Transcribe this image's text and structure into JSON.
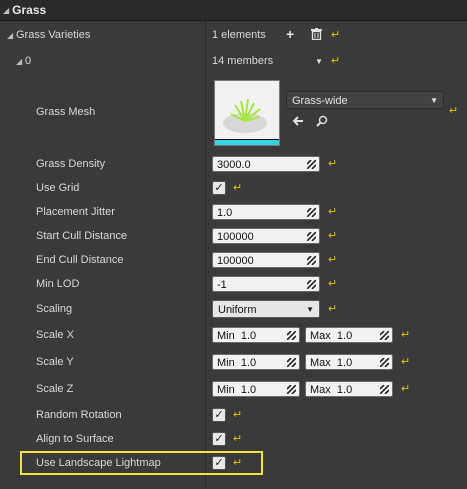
{
  "panel": {
    "title": "Grass"
  },
  "varieties": {
    "label": "Grass Varieties",
    "count": "1 elements"
  },
  "item": {
    "index": "0",
    "members": "14 members"
  },
  "mesh": {
    "label": "Grass Mesh",
    "asset": "Grass-wide"
  },
  "props": {
    "density": {
      "label": "Grass Density",
      "value": "3000.0"
    },
    "use_grid": {
      "label": "Use Grid",
      "checked": true
    },
    "jitter": {
      "label": "Placement Jitter",
      "value": "1.0"
    },
    "start_cull": {
      "label": "Start Cull Distance",
      "value": "100000"
    },
    "end_cull": {
      "label": "End Cull Distance",
      "value": "100000"
    },
    "min_lod": {
      "label": "Min LOD",
      "value": "-1"
    },
    "scaling": {
      "label": "Scaling",
      "value": "Uniform"
    },
    "scale_x": {
      "label": "Scale X",
      "min_label": "Min",
      "min": "1.0",
      "max_label": "Max",
      "max": "1.0"
    },
    "scale_y": {
      "label": "Scale Y",
      "min_label": "Min",
      "min": "1.0",
      "max_label": "Max",
      "max": "1.0"
    },
    "scale_z": {
      "label": "Scale Z",
      "min_label": "Min",
      "min": "1.0",
      "max_label": "Max",
      "max": "1.0"
    },
    "random_rotation": {
      "label": "Random Rotation",
      "checked": true
    },
    "align_surface": {
      "label": "Align to Surface",
      "checked": true
    },
    "landscape_lightmap": {
      "label": "Use Landscape Lightmap",
      "checked": true
    }
  },
  "icons": {
    "reset": "reset-arrow-icon",
    "add": "plus-icon",
    "delete": "trash-icon",
    "browse": "arrow-left-icon",
    "find": "magnifier-icon"
  },
  "colors": {
    "highlight": "#f2e63a",
    "reset": "#e7c000",
    "thumb_accent": "#36d3e6"
  }
}
